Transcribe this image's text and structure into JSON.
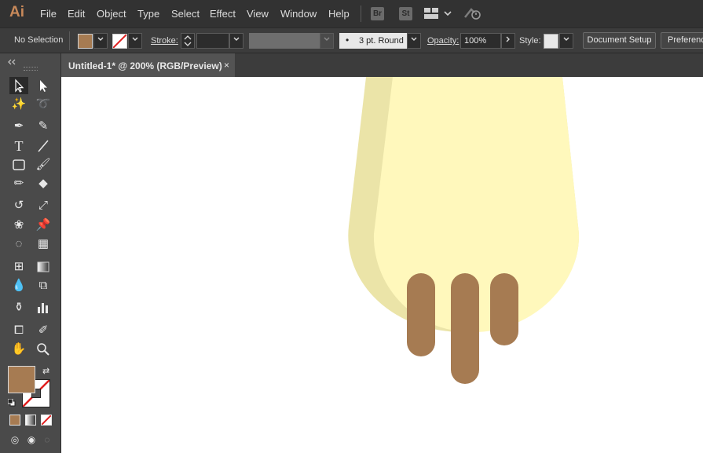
{
  "app": {
    "logo": "Ai"
  },
  "menu": [
    "File",
    "Edit",
    "Object",
    "Type",
    "Select",
    "Effect",
    "View",
    "Window",
    "Help"
  ],
  "top_icons": {
    "bridge": "Br",
    "stock": "St"
  },
  "control_bar": {
    "selection": "No Selection",
    "stroke_label": "Stroke:",
    "brush": "3 pt. Round",
    "opacity_label": "Opacity:",
    "opacity_value": "100%",
    "style_label": "Style:",
    "document_setup": "Document Setup",
    "preferences": "Preferences"
  },
  "document_tab": {
    "title": "Untitled-1* @ 200% (RGB/Preview)",
    "close": "×"
  },
  "colors": {
    "fill": "#a67b52",
    "bulb_outer": "#ebe4a8",
    "bulb_inner": "#fff8bc",
    "canvas": "#ffffff"
  },
  "icons": [
    "selection-tool-icon",
    "direct-selection-tool-icon",
    "magic-wand-icon",
    "lasso-icon",
    "pen-tool-icon",
    "curvature-tool-icon",
    "type-tool-icon",
    "line-tool-icon",
    "rectangle-tool-icon",
    "paintbrush-icon",
    "shaper-tool-icon",
    "eraser-icon",
    "rotate-tool-icon",
    "scale-tool-icon",
    "warp-tool-icon",
    "puppet-warp-icon",
    "shape-builder-icon",
    "perspective-grid-icon",
    "mesh-tool-icon",
    "gradient-tool-icon",
    "eyedropper-icon",
    "blend-tool-icon",
    "symbol-sprayer-icon",
    "column-graph-icon",
    "artboard-tool-icon",
    "slice-tool-icon",
    "hand-tool-icon",
    "zoom-icon"
  ]
}
